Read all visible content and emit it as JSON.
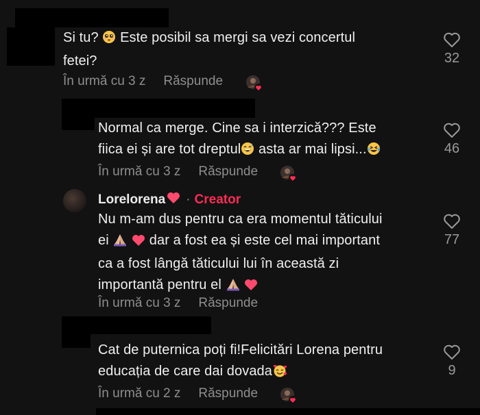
{
  "comments": [
    {
      "text_line1": "Si tu? ",
      "text_line1b": " Este posibil sa mergi sa vezi concertul",
      "text_line2": "fetei?",
      "time": "În urmă cu 3 z",
      "reply": "Răspunde",
      "likes": "32"
    },
    {
      "text_line1": "Normal ca merge. Cine sa i interzică??? Este",
      "text_line2a": "fiica ei și are tot dreptul",
      "text_line2b": " asta ar mai lipsi...",
      "time": "În urmă cu 3 z",
      "reply": "Răspunde",
      "likes": "46"
    },
    {
      "author": "Lorelorena",
      "separator": "·",
      "badge": "Creator",
      "line1": "Nu m-am dus pentru ca era momentul tăticului",
      "line2a": "ei ",
      "line2b": " dar a fost ea și este cel mai important",
      "line3": "ca a fost lângă tăticului lui în această zi",
      "line4": "importantă pentru el ",
      "time": "În urmă cu 3 z",
      "reply": "Răspunde",
      "likes": "77"
    },
    {
      "line1": "Cat de puternica poți fi!Felicitări Lorena pentru",
      "line2": "educația de care dai dovada",
      "time": "În urmă cu 2 z",
      "reply": "Răspunde",
      "likes": "9"
    }
  ],
  "colors": {
    "creator": "#fe2c55",
    "heart_red": "#ff2d55"
  }
}
